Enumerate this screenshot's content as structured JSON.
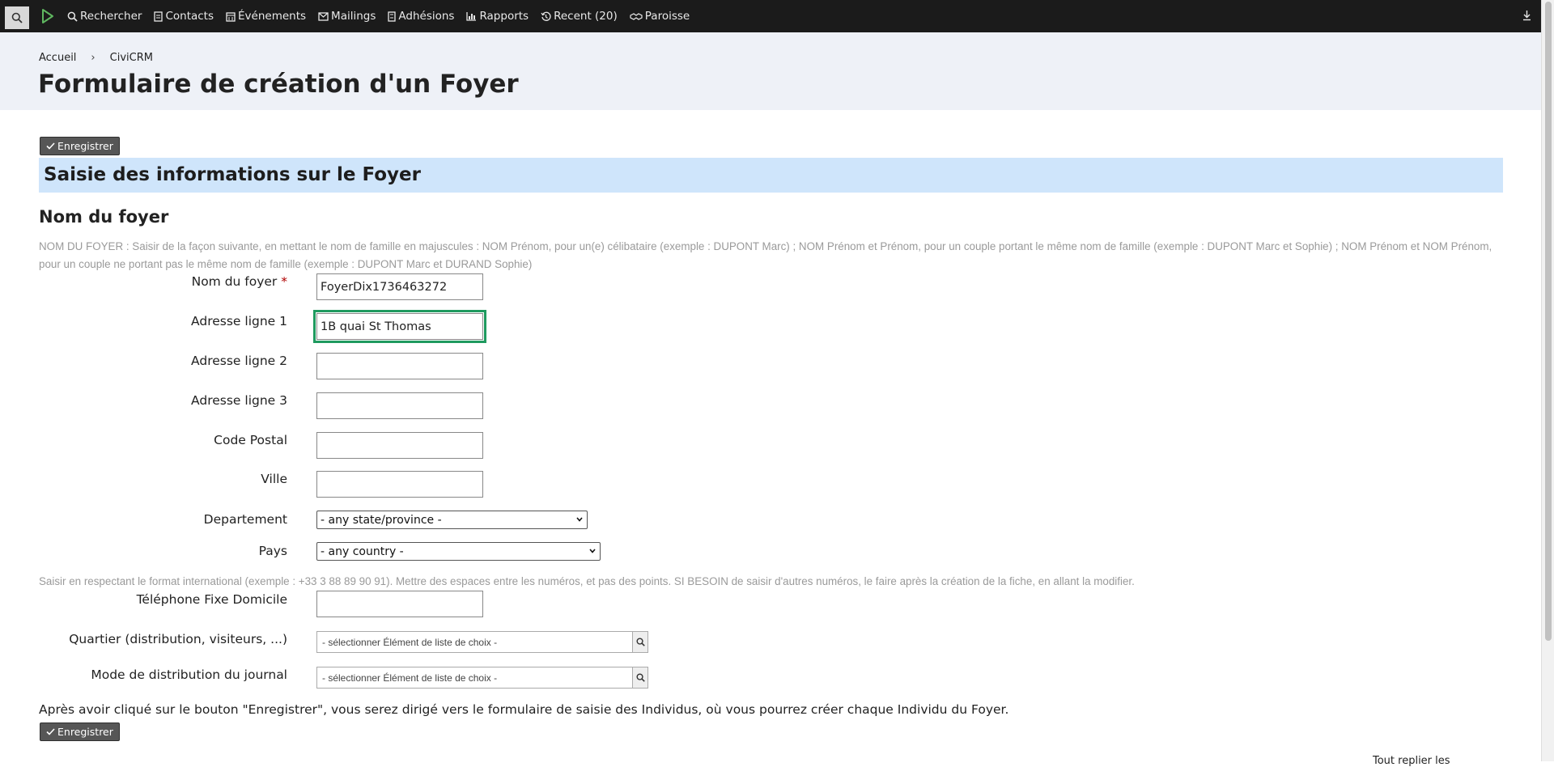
{
  "menubar": {
    "items": [
      {
        "label": "Rechercher",
        "icon": "search-icon"
      },
      {
        "label": "Contacts",
        "icon": "address-card-icon"
      },
      {
        "label": "Événements",
        "icon": "calendar-icon"
      },
      {
        "label": "Mailings",
        "icon": "envelope-icon"
      },
      {
        "label": "Adhésions",
        "icon": "id-badge-icon"
      },
      {
        "label": "Rapports",
        "icon": "bar-chart-icon"
      },
      {
        "label": "Recent (20)",
        "icon": "history-icon"
      },
      {
        "label": "Paroisse",
        "icon": "handshake-icon"
      }
    ]
  },
  "breadcrumb": {
    "home": "Accueil",
    "separator": "›",
    "current": "CiviCRM"
  },
  "page": {
    "title": "Formulaire de création d'un Foyer"
  },
  "buttons": {
    "save_label": "Enregistrer"
  },
  "section": {
    "title": "Saisie des informations sur le Foyer"
  },
  "group": {
    "title": "Nom du foyer"
  },
  "help": {
    "name_line1": "NOM DU FOYER : Saisir de la façon suivante, en mettant le nom de famille en majuscules : NOM Prénom, pour un(e) célibataire (exemple : DUPONT Marc) ; NOM Prénom et Prénom, pour un couple portant le même nom de famille (exemple : DUPONT Marc et Sophie) ; NOM Prénom et NOM Prénom,",
    "name_line2": "pour un couple ne portant pas le même nom de famille (exemple : DUPONT Marc et DURAND Sophie)",
    "phone": "Saisir en respectant le format international (exemple : +33 3 88 89 90 91). Mettre des espaces entre les numéros, et pas des points. SI BESOIN de saisir d'autres numéros, le faire après la création de la fiche, en allant la modifier."
  },
  "fields": {
    "household_name": {
      "label": "Nom du foyer",
      "required_mark": "*",
      "value": "FoyerDix1736463272"
    },
    "address1": {
      "label": "Adresse ligne 1",
      "value": "1B quai St Thomas"
    },
    "address2": {
      "label": "Adresse ligne 2",
      "value": ""
    },
    "address3": {
      "label": "Adresse ligne 3",
      "value": ""
    },
    "postal_code": {
      "label": "Code Postal",
      "value": ""
    },
    "city": {
      "label": "Ville",
      "value": ""
    },
    "state": {
      "label": "Departement",
      "value": "- any state/province -"
    },
    "country": {
      "label": "Pays",
      "value": "- any country -"
    },
    "phone": {
      "label": "Téléphone Fixe Domicile",
      "value": ""
    },
    "district": {
      "label": "Quartier (distribution, visiteurs, ...)",
      "placeholder": "- sélectionner Élément de liste de choix -"
    },
    "journal": {
      "label": "Mode de distribution du journal",
      "placeholder": "- sélectionner Élément de liste de choix -"
    }
  },
  "after_save_text": "Après avoir cliqué sur le bouton \"Enregistrer\", vous serez dirigé vers le formulaire de saisie des Individus, où vous pourrez créer chaque Individu du Foyer.",
  "footer": {
    "partial_link": "Tout replier les"
  },
  "colors": {
    "menubar": "#1b1b1b",
    "header": "#eef1f7",
    "section": "#cfe5fb",
    "button": "#565656",
    "focus": "#1f9a5f",
    "required": "#b00000"
  }
}
